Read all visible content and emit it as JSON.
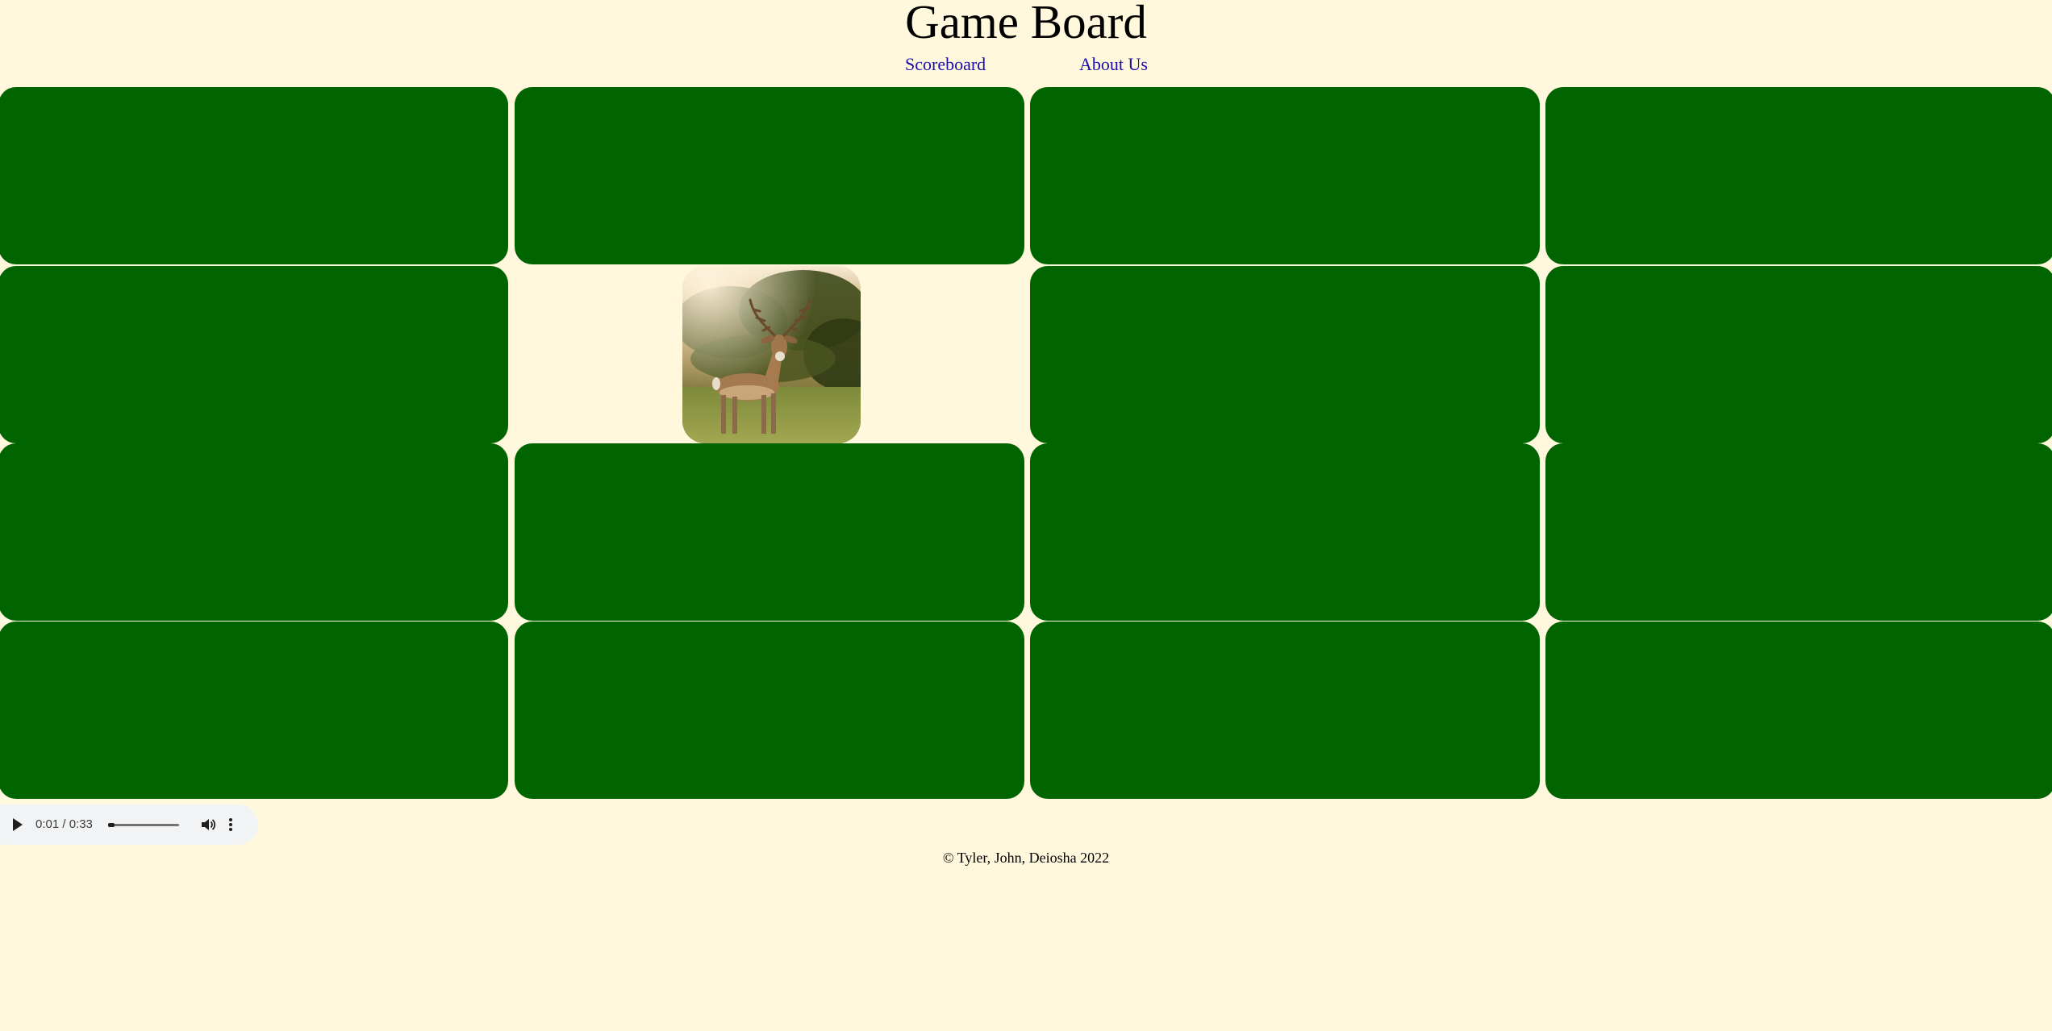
{
  "header": {
    "title": "Game Board"
  },
  "nav": {
    "scoreboard": "Scoreboard",
    "about": "About Us"
  },
  "board": {
    "rows": 4,
    "columns": 4,
    "card_color": "#006400",
    "background_color": "#fff8dc",
    "revealed_card": {
      "row": 2,
      "column": 2,
      "image": "deer-photo"
    }
  },
  "audio": {
    "time": "0:01 / 0:33",
    "progress": 0.03,
    "controls": [
      "play-icon",
      "volume-icon",
      "more-options-icon"
    ]
  },
  "footer": {
    "copyright": "© Tyler, John, Deiosha 2022"
  }
}
